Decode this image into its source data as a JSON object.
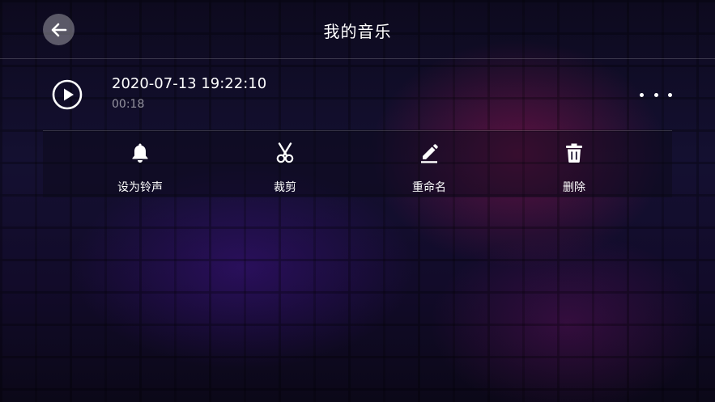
{
  "header": {
    "title": "我的音乐",
    "back_icon": "arrow-left-icon"
  },
  "recording": {
    "name": "2020-07-13 19:22:10",
    "duration": "00:18",
    "play_icon": "play-circle-icon",
    "more_icon": "more-horizontal-icon"
  },
  "actions": [
    {
      "label": "设为铃声",
      "icon": "bell-icon"
    },
    {
      "label": "裁剪",
      "icon": "scissors-icon"
    },
    {
      "label": "重命名",
      "icon": "pencil-icon"
    },
    {
      "label": "删除",
      "icon": "trash-icon"
    }
  ],
  "colors": {
    "background": "#141031",
    "accent_red": "#961450",
    "accent_purple": "#461496",
    "text": "#ffffff",
    "subtext": "#8c8a99"
  }
}
